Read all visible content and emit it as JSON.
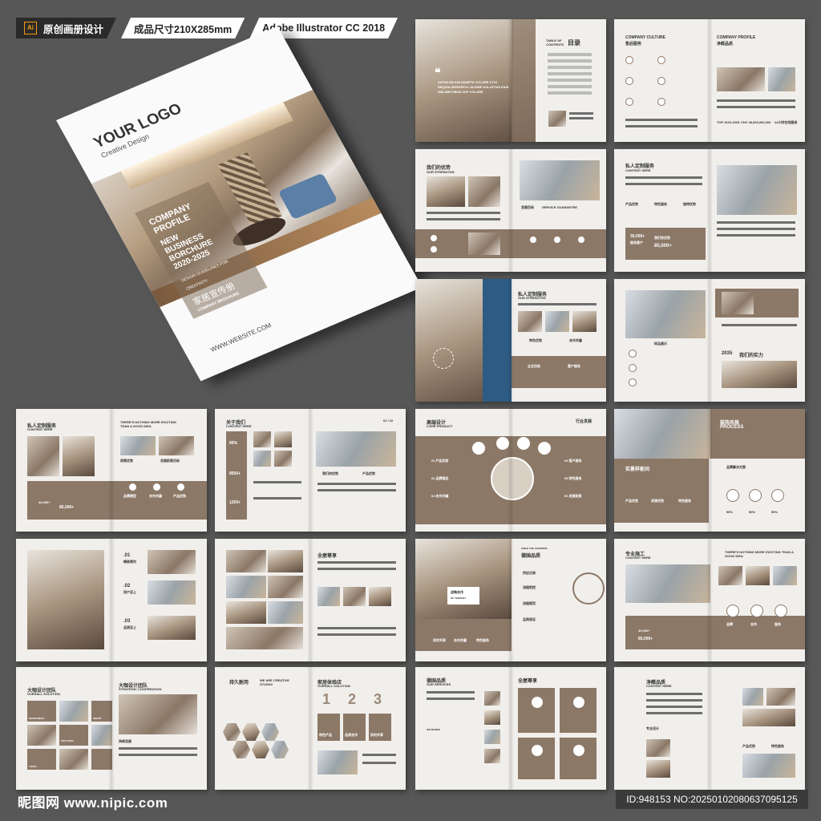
{
  "topbar": {
    "tag1": "原创画册设计",
    "tag1_icon": "Ai",
    "tag2": "成品尺寸210X285mm",
    "tag3": "Adobe Illustrator CC 2018"
  },
  "cover": {
    "logo": "YOUR LOGO",
    "sublogo": "Creative Design",
    "title_lines": [
      "COMPANY",
      "PROFILE",
      "NEW",
      "BUSINESS",
      "BORCHURE",
      "2020-2025"
    ],
    "design_line": "DESIGN GUIDELINES FOR CREATIVITY",
    "cn_title": "家居宣传册",
    "cn_sub": "COMPANY BROCHURE",
    "website": "WWW.WEBSITE.COM"
  },
  "spreads": [
    {
      "id": "s1",
      "left": "",
      "title": "目录",
      "subtitle": "TABLE OF CONTENTS",
      "quote": "ANTIM GB IUN NAMPTA VOLORE CTIO NEQUIA DERISPEVL ALIGNE DOLUPTAS EIUS SIM AMUTIBUS CUP VOLORE"
    },
    {
      "id": "s2",
      "left_en": "COMPANY CULTURE",
      "left_cn": "售后服务",
      "right_en": "COMPANY PROFILE",
      "right_cn": "净醛品质",
      "stat1": "TOP 2020-2025",
      "stat2": "CNY 45,325,000,000",
      "stat3": "24小时在线服务"
    },
    {
      "id": "s3",
      "cn": "我们的优势",
      "en": "OUR STRENGTHS",
      "tag1": "发展目标",
      "tag2": "SERVICE GUARANTEE"
    },
    {
      "id": "s4",
      "cn": "私人定制服务",
      "en": "CONTENT HERE",
      "i1": "产品优势",
      "i2": "特色服务",
      "i3": "独特优势",
      "stat1": "30,000+",
      "stat2": "85,000+",
      "stat1_label": "服务客户",
      "center": "我们的优势"
    },
    {
      "id": "s5",
      "cn": "私人定制服务",
      "en": "OUR STRENGTHS",
      "a": "特色优势",
      "b": "合作共赢",
      "c": "企业目标",
      "d": "客户服务"
    },
    {
      "id": "s6",
      "cn": "我们的实力",
      "num": "2035",
      "cap": "样品展示"
    },
    {
      "id": "s7",
      "cn": "私人定制服务",
      "en": "CONTENT HERE",
      "head": "THERE'S NOTHING MORE EXCITING THAN A GOOD IDEA",
      "l1": "政策优势",
      "l2": "发展前景目标",
      "stat1": "30,000+",
      "stat2": "85,000+",
      "i1": "品牌模型",
      "i2": "合作共赢",
      "i3": "产品优势"
    },
    {
      "id": "s8",
      "cn": "关于我们",
      "en": "CONTENT HERE",
      "page": "01 / 02",
      "v1": "85%",
      "v2": "8500+",
      "v3": "1200+",
      "a": "我们的优势",
      "b": "产品优势"
    },
    {
      "id": "s9",
      "cn": "高端设计",
      "en": "CORE PRODUCT",
      "right": "行业发展",
      "l1": "01 产品优势",
      "l2": "02 品牌理念",
      "l3": "03 合作共赢",
      "r1": "04 客户服务",
      "r2": "05 特色服务",
      "r3": "06 发展前景"
    },
    {
      "id": "s10",
      "cn": "装饰风格",
      "en": "PROCESS",
      "a": "实景样板间",
      "b": "品牌解决方案",
      "p1": "90%",
      "p2": "90%",
      "p3": "90%",
      "i1": "产品优势",
      "i2": "资源优势",
      "i3": "特色服务"
    },
    {
      "id": "s11",
      "n1": ".01",
      "t1": "精致简约",
      "n2": ".02",
      "t2": "用户至上",
      "n3": ".03",
      "t3": "品质至上"
    },
    {
      "id": "s12",
      "cn": "全屋尊享"
    },
    {
      "id": "s13",
      "cn": "德国品质",
      "en": "SINCE THE FOUNDING",
      "c1": "战略合作",
      "c1en": "OF TENCENT",
      "l1": "供应记录",
      "l2": "流程把控",
      "l3": "流程规范",
      "l4": "品质保证",
      "b1": "实时共享",
      "b2": "合作共赢",
      "b3": "特色服务"
    },
    {
      "id": "s14",
      "cn": "专业施工",
      "en": "CONTENT HERE",
      "head": "THERE'S NOTHING MORE EXCITING THAN A GOOD IDEA",
      "stat1": "30,000+",
      "stat2": "85,000+",
      "i1": "品牌",
      "i2": "合作",
      "i3": "服务"
    },
    {
      "id": "s15",
      "cn": "大咖设计团队",
      "en": "OVERALL SOLUTION",
      "right_cn": "大咖设计团队",
      "right_en": "STRATEGIC COOPERATION",
      "a": "INVESTMENT",
      "b": "SMART",
      "c": "SOLUTION",
      "d": "LOGIN",
      "e": "持续发展"
    },
    {
      "id": "s16",
      "cn": "持久耐用",
      "en": "WE ARE CREATIVE STUDIO!",
      "right_cn": "家居体验店",
      "right_en": "OVERALL SOLUTION",
      "n1": "1",
      "n2": "2",
      "n3": "3",
      "t1": "特色产品",
      "t2": "品质合作",
      "t3": "实时共享"
    },
    {
      "id": "s17",
      "cn": "德国品质",
      "en": "OUR SERVICES",
      "right_cn": "全屋尊享",
      "side": "WE WORKS"
    },
    {
      "id": "s18",
      "cn": "净醛品质",
      "en": "CONTENT HERE",
      "a": "专业设计",
      "b": "产品优势",
      "c": "特色服务"
    }
  ],
  "footer": {
    "brand": "昵图网 www.nipic.com",
    "id": "ID:948153 NO:20250102080637095125"
  }
}
